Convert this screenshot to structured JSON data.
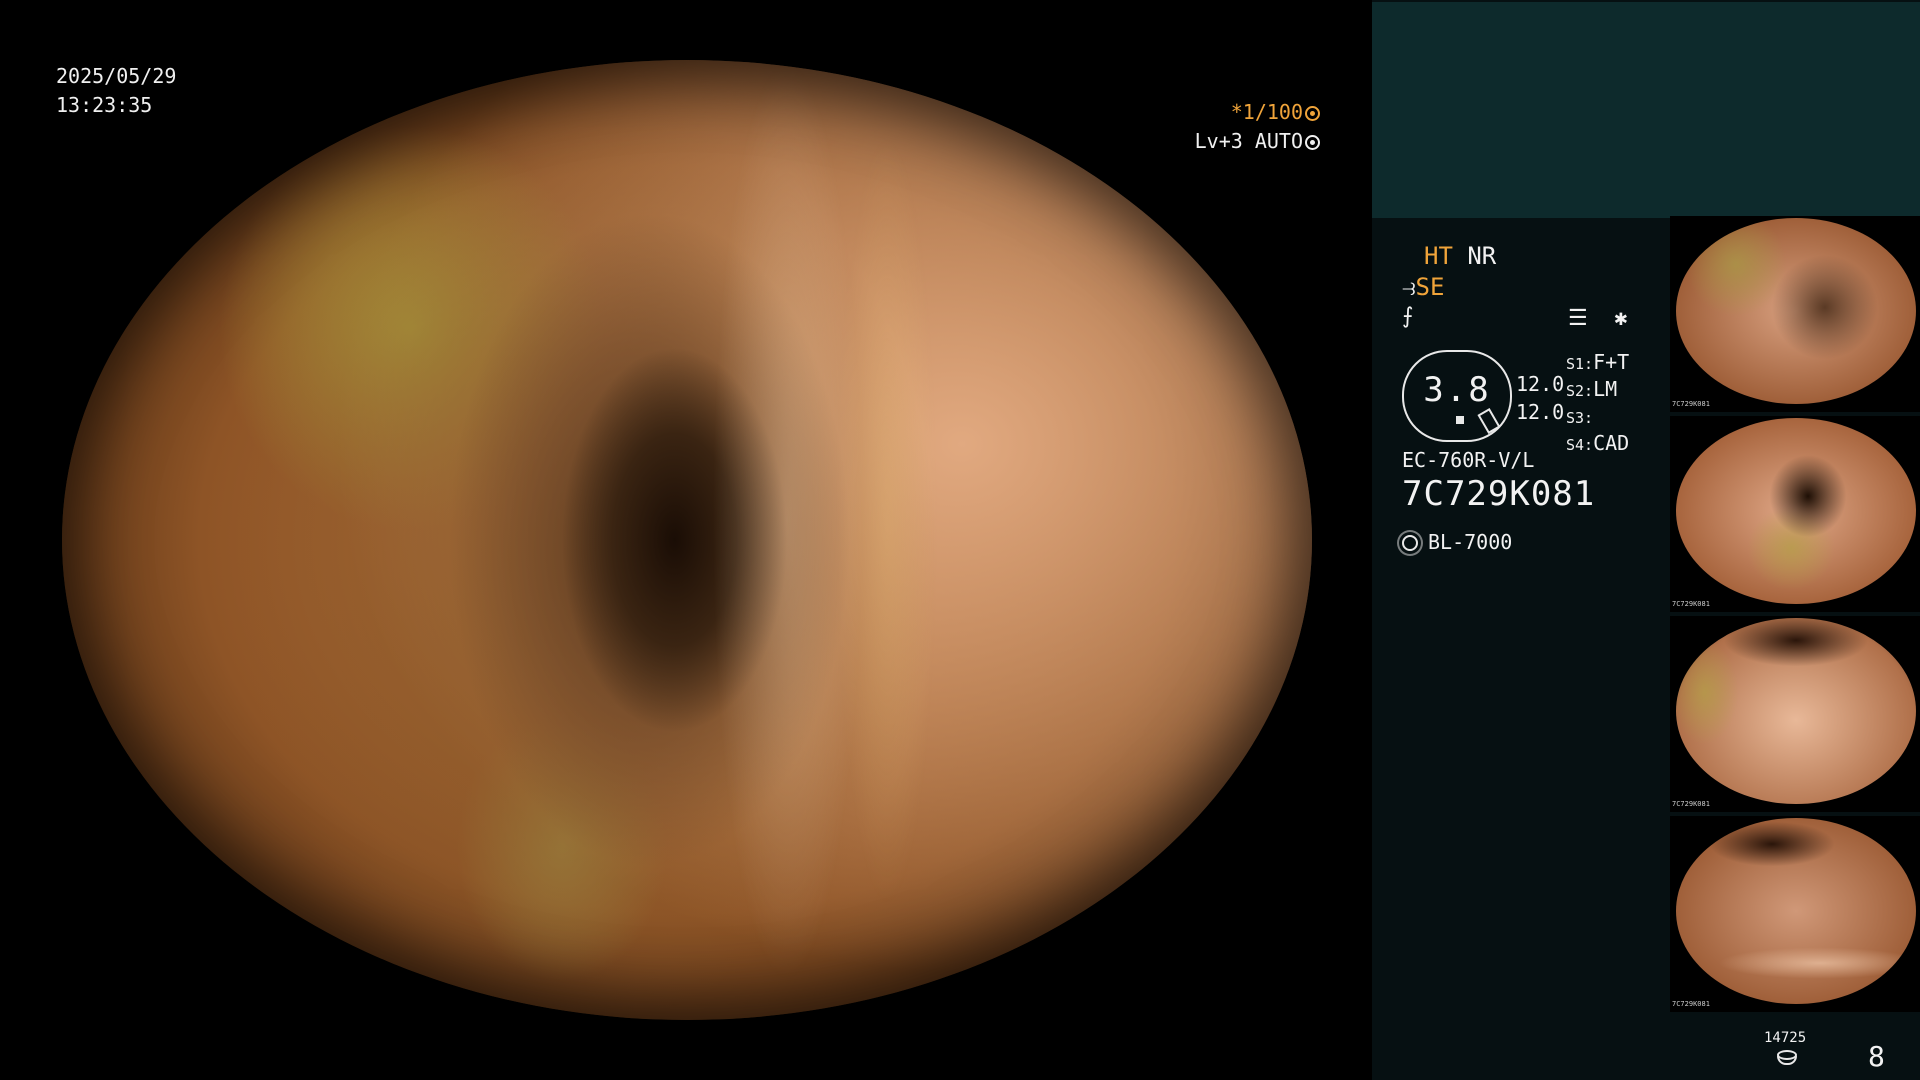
{
  "overlay": {
    "date": "2025/05/29",
    "time": "13:23:35",
    "shutter": "*1/100",
    "level": "Lv+3",
    "mode": "AUTO"
  },
  "panel": {
    "ht": "HT",
    "nr": "NR",
    "se": "SE",
    "gauge_value": "3.8",
    "gauge_nums": [
      "12.0",
      "12.0"
    ],
    "settings": [
      {
        "key": "S1:",
        "value": "F+T"
      },
      {
        "key": "S2:",
        "value": "LM"
      },
      {
        "key": "S3:",
        "value": ""
      },
      {
        "key": "S4:",
        "value": "CAD"
      }
    ],
    "scope_model": "EC-760R-V/L",
    "scope_serial": "7C729K081",
    "light_source": "BL-7000",
    "counter": "14725",
    "page_count": "8"
  },
  "thumbnails": [
    {
      "caption": "7C729K081"
    },
    {
      "caption": "7C729K081"
    },
    {
      "caption": "7C729K081"
    },
    {
      "caption": "7C729K081"
    }
  ],
  "colors": {
    "accent": "#f0a43a",
    "panel_bg": "#061012",
    "panel_top": "#0d2a2c"
  }
}
